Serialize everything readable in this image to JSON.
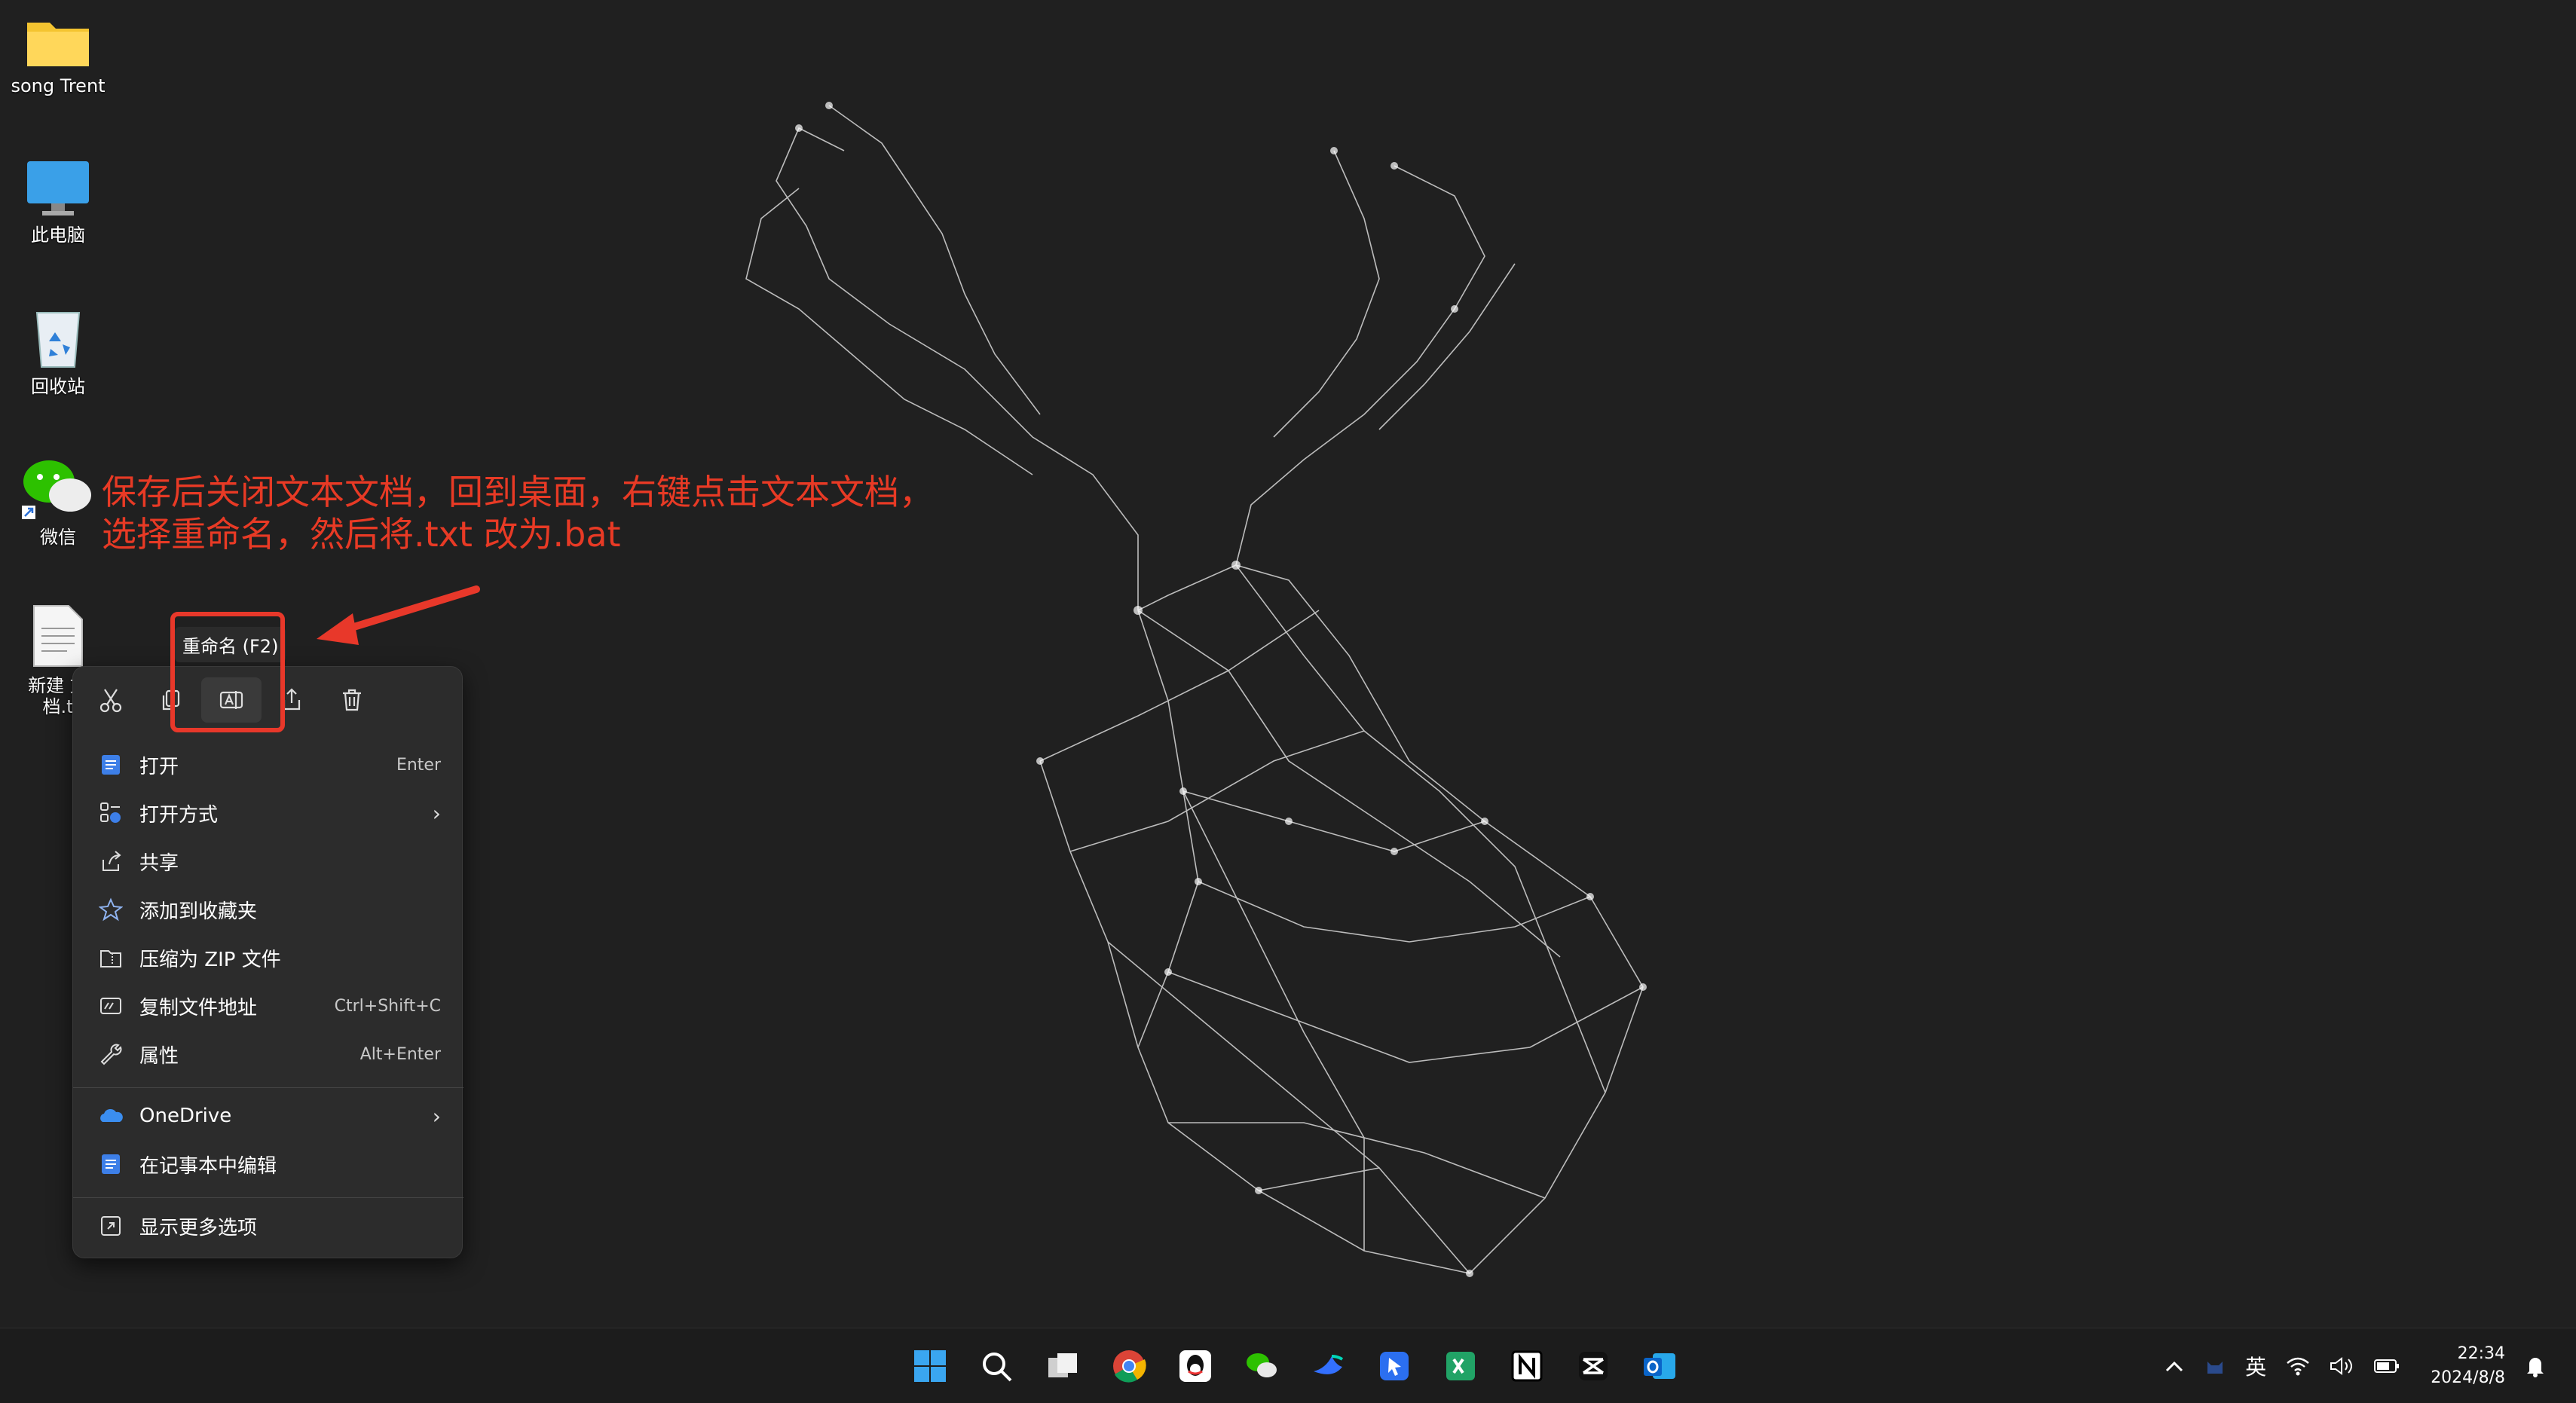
{
  "desktop": {
    "icons": [
      {
        "label": "song Trent",
        "icon": "folder-icon"
      },
      {
        "label": "此电脑",
        "icon": "monitor-icon"
      },
      {
        "label": "回收站",
        "icon": "recycle-bin-icon"
      },
      {
        "label": "微信",
        "icon": "wechat-icon"
      },
      {
        "label": "新建 文\n档.t",
        "icon": "text-file-icon"
      }
    ]
  },
  "annotation": {
    "line1": "保存后关闭文本文档，回到桌面，右键点击文本文档，",
    "line2": "选择重命名，然后将.txt 改为.bat",
    "color": "#e83a25"
  },
  "tooltip": {
    "text": "重命名 (F2)"
  },
  "context_menu": {
    "toolbar": [
      {
        "name": "cut",
        "icon": "scissors-icon"
      },
      {
        "name": "copy",
        "icon": "copy-icon"
      },
      {
        "name": "rename",
        "icon": "rename-icon",
        "active": true
      },
      {
        "name": "share",
        "icon": "share-icon"
      },
      {
        "name": "delete",
        "icon": "trash-icon"
      }
    ],
    "items": [
      {
        "label": "打开",
        "shortcut": "Enter",
        "icon": "notepad-icon"
      },
      {
        "label": "打开方式",
        "shortcut": "",
        "icon": "open-with-icon",
        "submenu": true
      },
      {
        "label": "共享",
        "shortcut": "",
        "icon": "share-icon"
      },
      {
        "label": "添加到收藏夹",
        "shortcut": "",
        "icon": "star-icon"
      },
      {
        "label": "压缩为 ZIP 文件",
        "shortcut": "",
        "icon": "zip-icon"
      },
      {
        "label": "复制文件地址",
        "shortcut": "Ctrl+Shift+C",
        "icon": "copy-path-icon"
      },
      {
        "label": "属性",
        "shortcut": "Alt+Enter",
        "icon": "wrench-icon"
      },
      {
        "label": "OneDrive",
        "shortcut": "",
        "icon": "onedrive-icon",
        "submenu": true
      },
      {
        "label": "在记事本中编辑",
        "shortcut": "",
        "icon": "notepad-icon"
      },
      {
        "label": "显示更多选项",
        "shortcut": "",
        "icon": "more-options-icon"
      }
    ]
  },
  "taskbar": {
    "apps": [
      "start-icon",
      "search-icon",
      "task-view-icon",
      "chrome-icon",
      "qq-icon",
      "wechat-icon",
      "feishu-icon",
      "pointer-app-icon",
      "terminal-icon",
      "notion-icon",
      "capcut-icon",
      "outlook-icon"
    ],
    "tray": {
      "ime": "英",
      "time": "22:34",
      "date": "2024/8/8"
    }
  },
  "colors": {
    "desktop_bg": "#202020",
    "menu_bg": "#2c2c2c",
    "highlight": "#e8382a",
    "accent": "#4f8ff7"
  }
}
